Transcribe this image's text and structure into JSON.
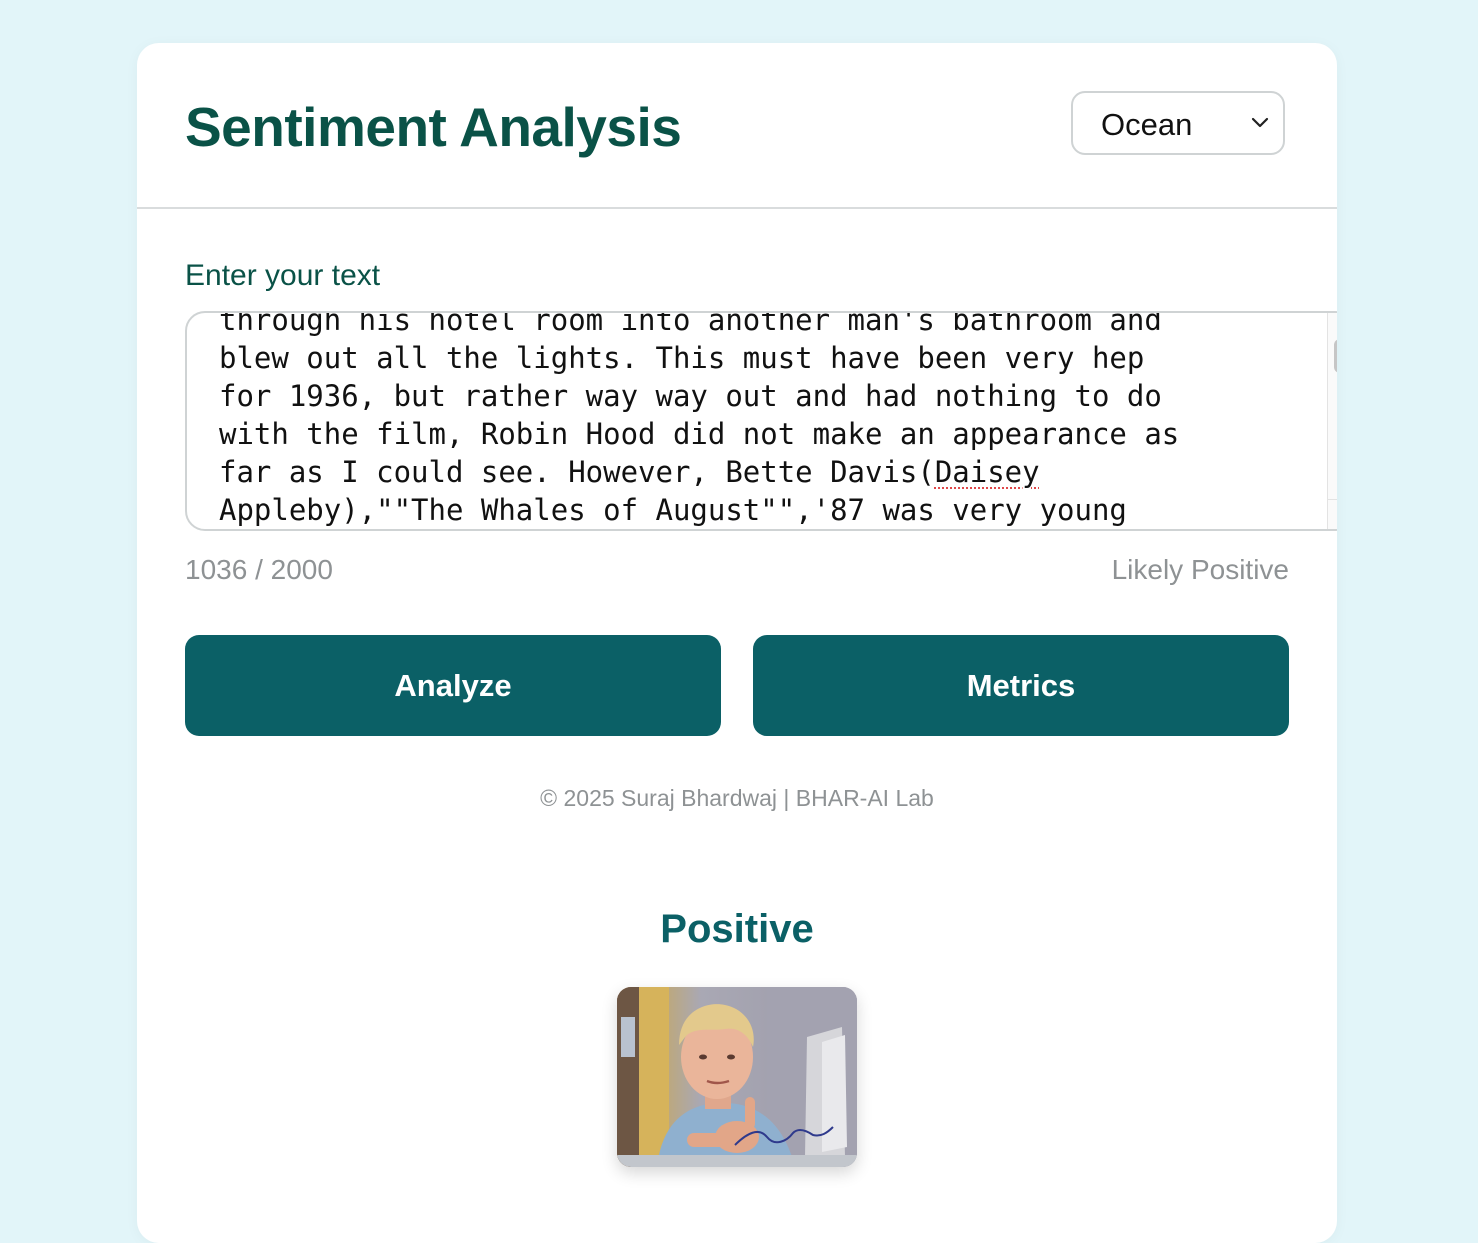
{
  "app": {
    "title": "Sentiment Analysis",
    "theme_select": {
      "selected": "Ocean"
    }
  },
  "input": {
    "label": "Enter your text",
    "lines": [
      "through his hotel room into another man's bathroom and",
      "blew out all the lights. This must have been very hep",
      "for 1936, but rather way way out and had nothing to do",
      "with the film, Robin Hood did not make an appearance as",
      "far as I could see. However, Bette Davis(",
      "Daisey",
      "Appleby),\"\"The Whales of August\"\",'87 was very young"
    ],
    "char_count": "1036 / 2000",
    "live_prediction": "Likely Positive"
  },
  "actions": {
    "analyze_label": "Analyze",
    "metrics_label": "Metrics"
  },
  "footer": {
    "copyright": "© 2025 Suraj Bhardwaj | BHAR-AI Lab"
  },
  "result": {
    "label": "Positive",
    "image": "thumbs-up-kid-gif"
  },
  "colors": {
    "background": "#e2f5f9",
    "title": "#0a5247",
    "button": "#0b6066",
    "muted_text": "#8e9294"
  }
}
